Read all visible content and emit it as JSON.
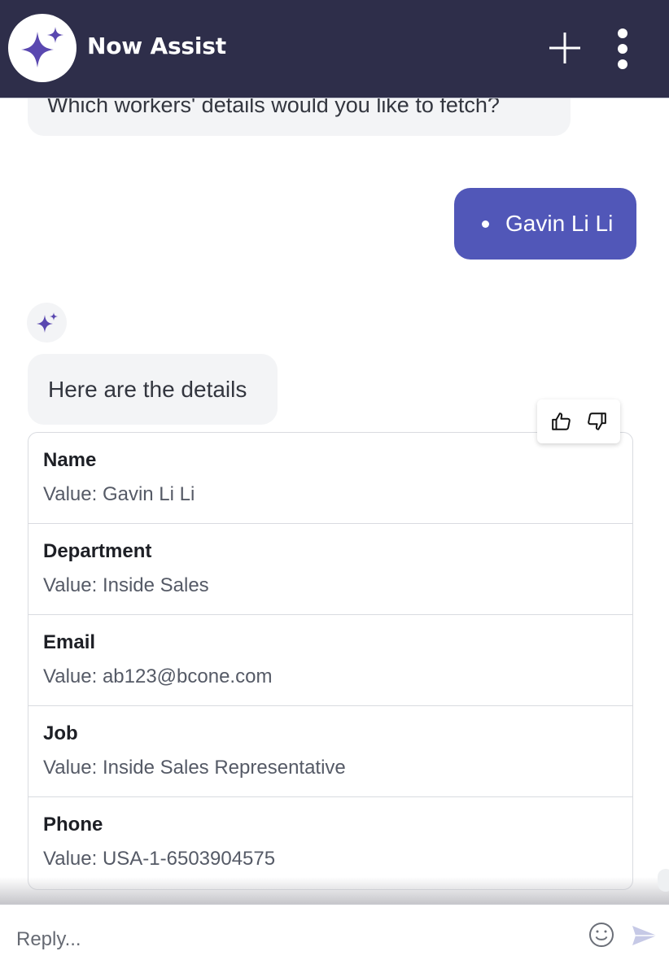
{
  "header": {
    "title": "Now Assist",
    "logo_icon": "sparkle-icon",
    "new_chat_icon": "plus-icon",
    "menu_icon": "kebab-menu-icon",
    "bg_color": "#2e2e4a",
    "accent_color": "#5a48b0"
  },
  "conversation": {
    "bot_question": "Which workers' details would you like to fetch?",
    "user_reply": "Gavin Li Li",
    "user_bubble_color": "#5157b8",
    "bot_intro": "Here are the details",
    "feedback": {
      "like_icon": "thumbs-up-icon",
      "dislike_icon": "thumbs-down-icon"
    },
    "details": [
      {
        "label": "Name",
        "value": "Value: Gavin Li Li"
      },
      {
        "label": "Department",
        "value": "Value: Inside Sales"
      },
      {
        "label": "Email",
        "value": "Value: ab123@bcone.com"
      },
      {
        "label": "Job",
        "value": "Value: Inside Sales Representative"
      },
      {
        "label": "Phone",
        "value": "Value: USA-1-6503904575"
      }
    ]
  },
  "composer": {
    "placeholder": "Reply...",
    "emoji_icon": "smiley-icon",
    "send_icon": "send-icon"
  }
}
